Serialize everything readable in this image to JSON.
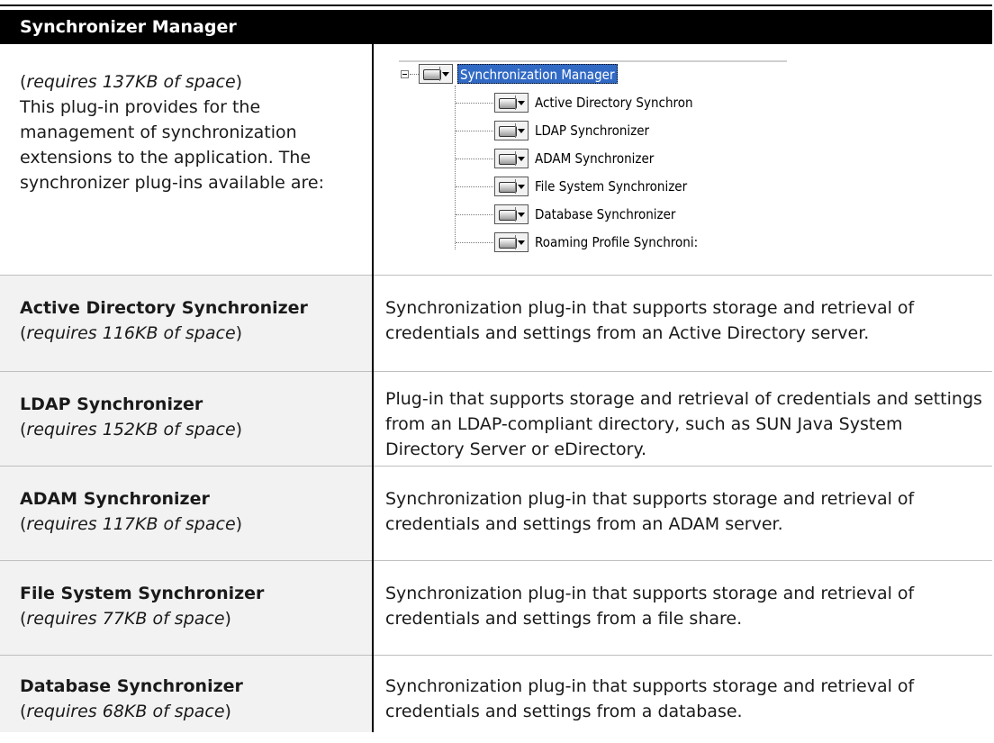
{
  "header": {
    "title": "Synchronizer Manager"
  },
  "intro": {
    "req_prefix": "(",
    "req_text": "requires 137KB of space",
    "req_suffix": ")",
    "body": "This plug-in provides for the management of synchronization extensions to the application. The synchronizer plug-ins available are:"
  },
  "tree": {
    "root": "Synchronization Manager",
    "children": [
      "Active Directory Synchron",
      "LDAP Synchronizer",
      "ADAM Synchronizer",
      "File System Synchronizer",
      "Database Synchronizer",
      "Roaming Profile Synchroni:"
    ]
  },
  "rows": [
    {
      "name": "Active Directory Synchronizer",
      "req": "requires 116KB of space",
      "desc": "Synchronization plug-in that supports storage and retrieval of credentials and settings from an Active Directory server."
    },
    {
      "name": "LDAP Synchronizer",
      "req": "requires 152KB of space",
      "desc": "Plug-in that supports storage and retrieval of credentials and settings from an LDAP-compliant directory, such as SUN Java System Directory Server or eDirectory."
    },
    {
      "name": "ADAM Synchronizer",
      "req": "requires 117KB of space",
      "desc": "Synchronization plug-in that supports storage and retrieval of credentials and settings from an ADAM server."
    },
    {
      "name": "File System Synchronizer",
      "req": "requires 77KB of space",
      "desc": "Synchronization plug-in that supports storage and retrieval of credentials and settings from a file share."
    },
    {
      "name": "Database Synchronizer",
      "req": "requires 68KB of space",
      "desc": "Synchronization plug-in that supports storage and retrieval of credentials and settings from a database."
    }
  ],
  "colors": {
    "header_bg": "#000000",
    "header_fg": "#ffffff",
    "left_cell_bg": "#f2f2f2",
    "selection": "#316ac5"
  }
}
